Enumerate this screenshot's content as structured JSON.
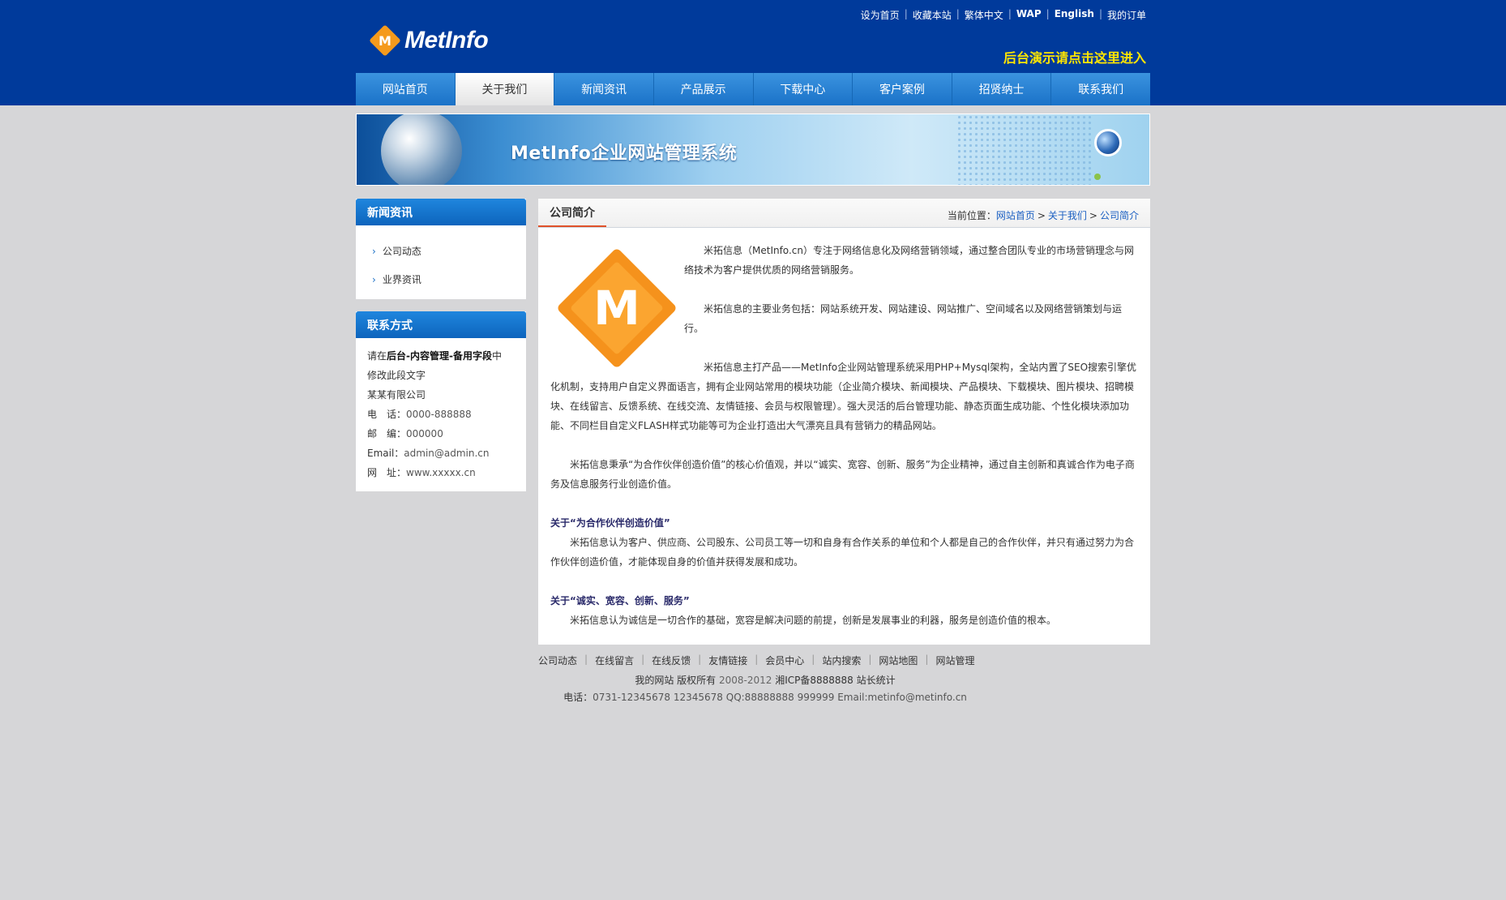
{
  "header": {
    "logo_text": "MetInfo",
    "logo_letter": "M",
    "top_links": [
      "设为首页",
      "收藏本站",
      "繁体中文",
      "WAP",
      "English",
      "我的订单"
    ],
    "admin_entry": "后台演示请点击这里进入"
  },
  "nav": {
    "items": [
      "网站首页",
      "关于我们",
      "新闻资讯",
      "产品展示",
      "下载中心",
      "客户案例",
      "招贤纳士",
      "联系我们"
    ],
    "active": "关于我们"
  },
  "banner": {
    "title": "MetInfo企业网站管理系统"
  },
  "sidebar": {
    "news": {
      "title": "新闻资讯",
      "items": [
        "公司动态",
        "业界资讯"
      ]
    },
    "contact": {
      "title": "联系方式",
      "line1_a": "请在",
      "line1_b": "后台-内容管理-备用字段",
      "line1_c": "中",
      "line2": "修改此段文字",
      "company": "某某有限公司",
      "phone_label": "电　话：",
      "phone": "0000-888888",
      "zip_label": "邮　编：",
      "zip": "000000",
      "email_label": "Email：",
      "email": "admin@admin.cn",
      "site_label": "网　址：",
      "site": "www.xxxxx.cn"
    }
  },
  "main": {
    "tab_title": "公司简介",
    "breadcrumb": {
      "label": "当前位置：",
      "items": [
        "网站首页",
        "关于我们",
        "公司简介"
      ]
    },
    "logo_letter": "M",
    "paragraphs": {
      "p1": "米拓信息（MetInfo.cn）专注于网络信息化及网络营销领域，通过整合团队专业的市场营销理念与网络技术为客户提供优质的网络营销服务。",
      "p2": "米拓信息的主要业务包括：网站系统开发、网站建设、网站推广、空间域名以及网络营销策划与运行。",
      "p3": "米拓信息主打产品——MetInfo企业网站管理系统采用PHP+Mysql架构，全站内置了SEO搜索引擎优化机制，支持用户自定义界面语言，拥有企业网站常用的模块功能（企业简介模块、新闻模块、产品模块、下载模块、图片模块、招聘模块、在线留言、反馈系统、在线交流、友情链接、会员与权限管理）。强大灵活的后台管理功能、静态页面生成功能、个性化模块添加功能、不同栏目自定义FLASH样式功能等可为企业打造出大气漂亮且具有营销力的精品网站。",
      "p4": "米拓信息秉承“为合作伙伴创造价值”的核心价值观，并以“诚实、宽容、创新、服务”为企业精神，通过自主创新和真诚合作为电子商务及信息服务行业创造价值。",
      "h1": "关于“为合作伙伴创造价值”",
      "p5": "米拓信息认为客户、供应商、公司股东、公司员工等一切和自身有合作关系的单位和个人都是自己的合作伙伴，并只有通过努力为合作伙伴创造价值，才能体现自身的价值并获得发展和成功。",
      "h2": "关于“诚实、宽容、创新、服务”",
      "p6": "米拓信息认为诚信是一切合作的基础，宽容是解决问题的前提，创新是发展事业的利器，服务是创造价值的根本。"
    }
  },
  "footer": {
    "links": [
      "公司动态",
      "在线留言",
      "在线反馈",
      "友情链接",
      "会员中心",
      "站内搜索",
      "网站地图",
      "网站管理"
    ],
    "copy_a": "我的网站 版权所有 ",
    "copy_years": "2008-2012",
    "copy_b": " 湘ICP备8888888 站长统计",
    "contact_label": "电话：",
    "contact_value": "0731-12345678 12345678 QQ:88888888 999999 Email:metinfo@metinfo.cn"
  }
}
